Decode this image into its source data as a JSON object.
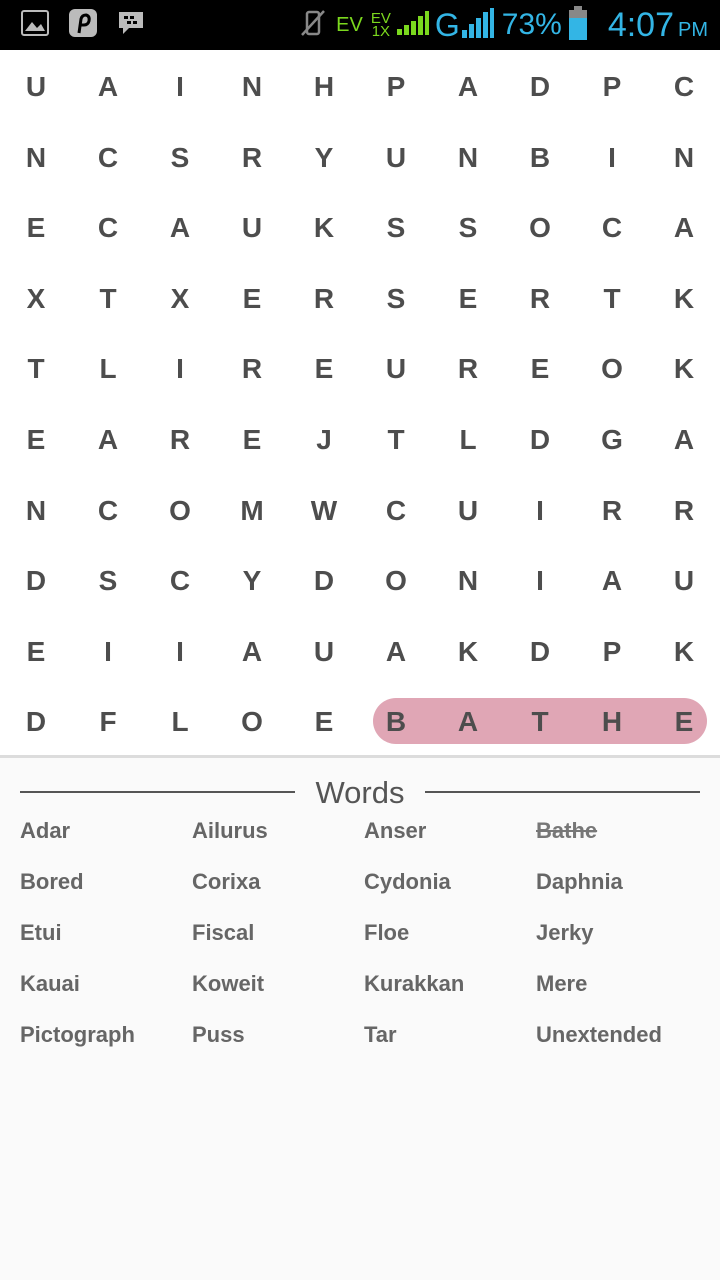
{
  "status_bar": {
    "left_icons": [
      "gallery-icon",
      "pinterest-icon",
      "bbm-icon"
    ],
    "right_icons": [
      "vibrate-off-icon",
      "signal-bars-icon"
    ],
    "network_ev": "EV",
    "network_ev1x_top": "EV",
    "network_ev1x_bottom": "1X",
    "network_type": "G",
    "battery_percent": "73%",
    "time": "4:07",
    "ampm": "PM"
  },
  "puzzle": {
    "grid": [
      [
        "U",
        "A",
        "I",
        "N",
        "H",
        "P",
        "A",
        "D",
        "P",
        "C"
      ],
      [
        "N",
        "C",
        "S",
        "R",
        "Y",
        "U",
        "N",
        "B",
        "I",
        "N"
      ],
      [
        "E",
        "C",
        "A",
        "U",
        "K",
        "S",
        "S",
        "O",
        "C",
        "A"
      ],
      [
        "X",
        "T",
        "X",
        "E",
        "R",
        "S",
        "E",
        "R",
        "T",
        "K"
      ],
      [
        "T",
        "L",
        "I",
        "R",
        "E",
        "U",
        "R",
        "E",
        "O",
        "K"
      ],
      [
        "E",
        "A",
        "R",
        "E",
        "J",
        "T",
        "L",
        "D",
        "G",
        "A"
      ],
      [
        "N",
        "C",
        "O",
        "M",
        "W",
        "C",
        "U",
        "I",
        "R",
        "R"
      ],
      [
        "D",
        "S",
        "C",
        "Y",
        "D",
        "O",
        "N",
        "I",
        "A",
        "U"
      ],
      [
        "E",
        "I",
        "I",
        "A",
        "U",
        "A",
        "K",
        "D",
        "P",
        "K"
      ],
      [
        "D",
        "F",
        "L",
        "O",
        "E",
        "B",
        "A",
        "T",
        "H",
        "E"
      ]
    ],
    "highlight_color": "#e0a6b5",
    "highlighted_word": "BATHE"
  },
  "words_panel": {
    "title": "Words",
    "words": [
      {
        "text": "Adar",
        "found": false
      },
      {
        "text": "Ailurus",
        "found": false
      },
      {
        "text": "Anser",
        "found": false
      },
      {
        "text": "Bathe",
        "found": true
      },
      {
        "text": "Bored",
        "found": false
      },
      {
        "text": "Corixa",
        "found": false
      },
      {
        "text": "Cydonia",
        "found": false
      },
      {
        "text": "Daphnia",
        "found": false
      },
      {
        "text": "Etui",
        "found": false
      },
      {
        "text": "Fiscal",
        "found": false
      },
      {
        "text": "Floe",
        "found": false
      },
      {
        "text": "Jerky",
        "found": false
      },
      {
        "text": "Kauai",
        "found": false
      },
      {
        "text": "Koweit",
        "found": false
      },
      {
        "text": "Kurakkan",
        "found": false
      },
      {
        "text": "Mere",
        "found": false
      },
      {
        "text": "Pictograph",
        "found": false
      },
      {
        "text": "Puss",
        "found": false
      },
      {
        "text": "Tar",
        "found": false
      },
      {
        "text": "Unextended",
        "found": false
      }
    ]
  }
}
